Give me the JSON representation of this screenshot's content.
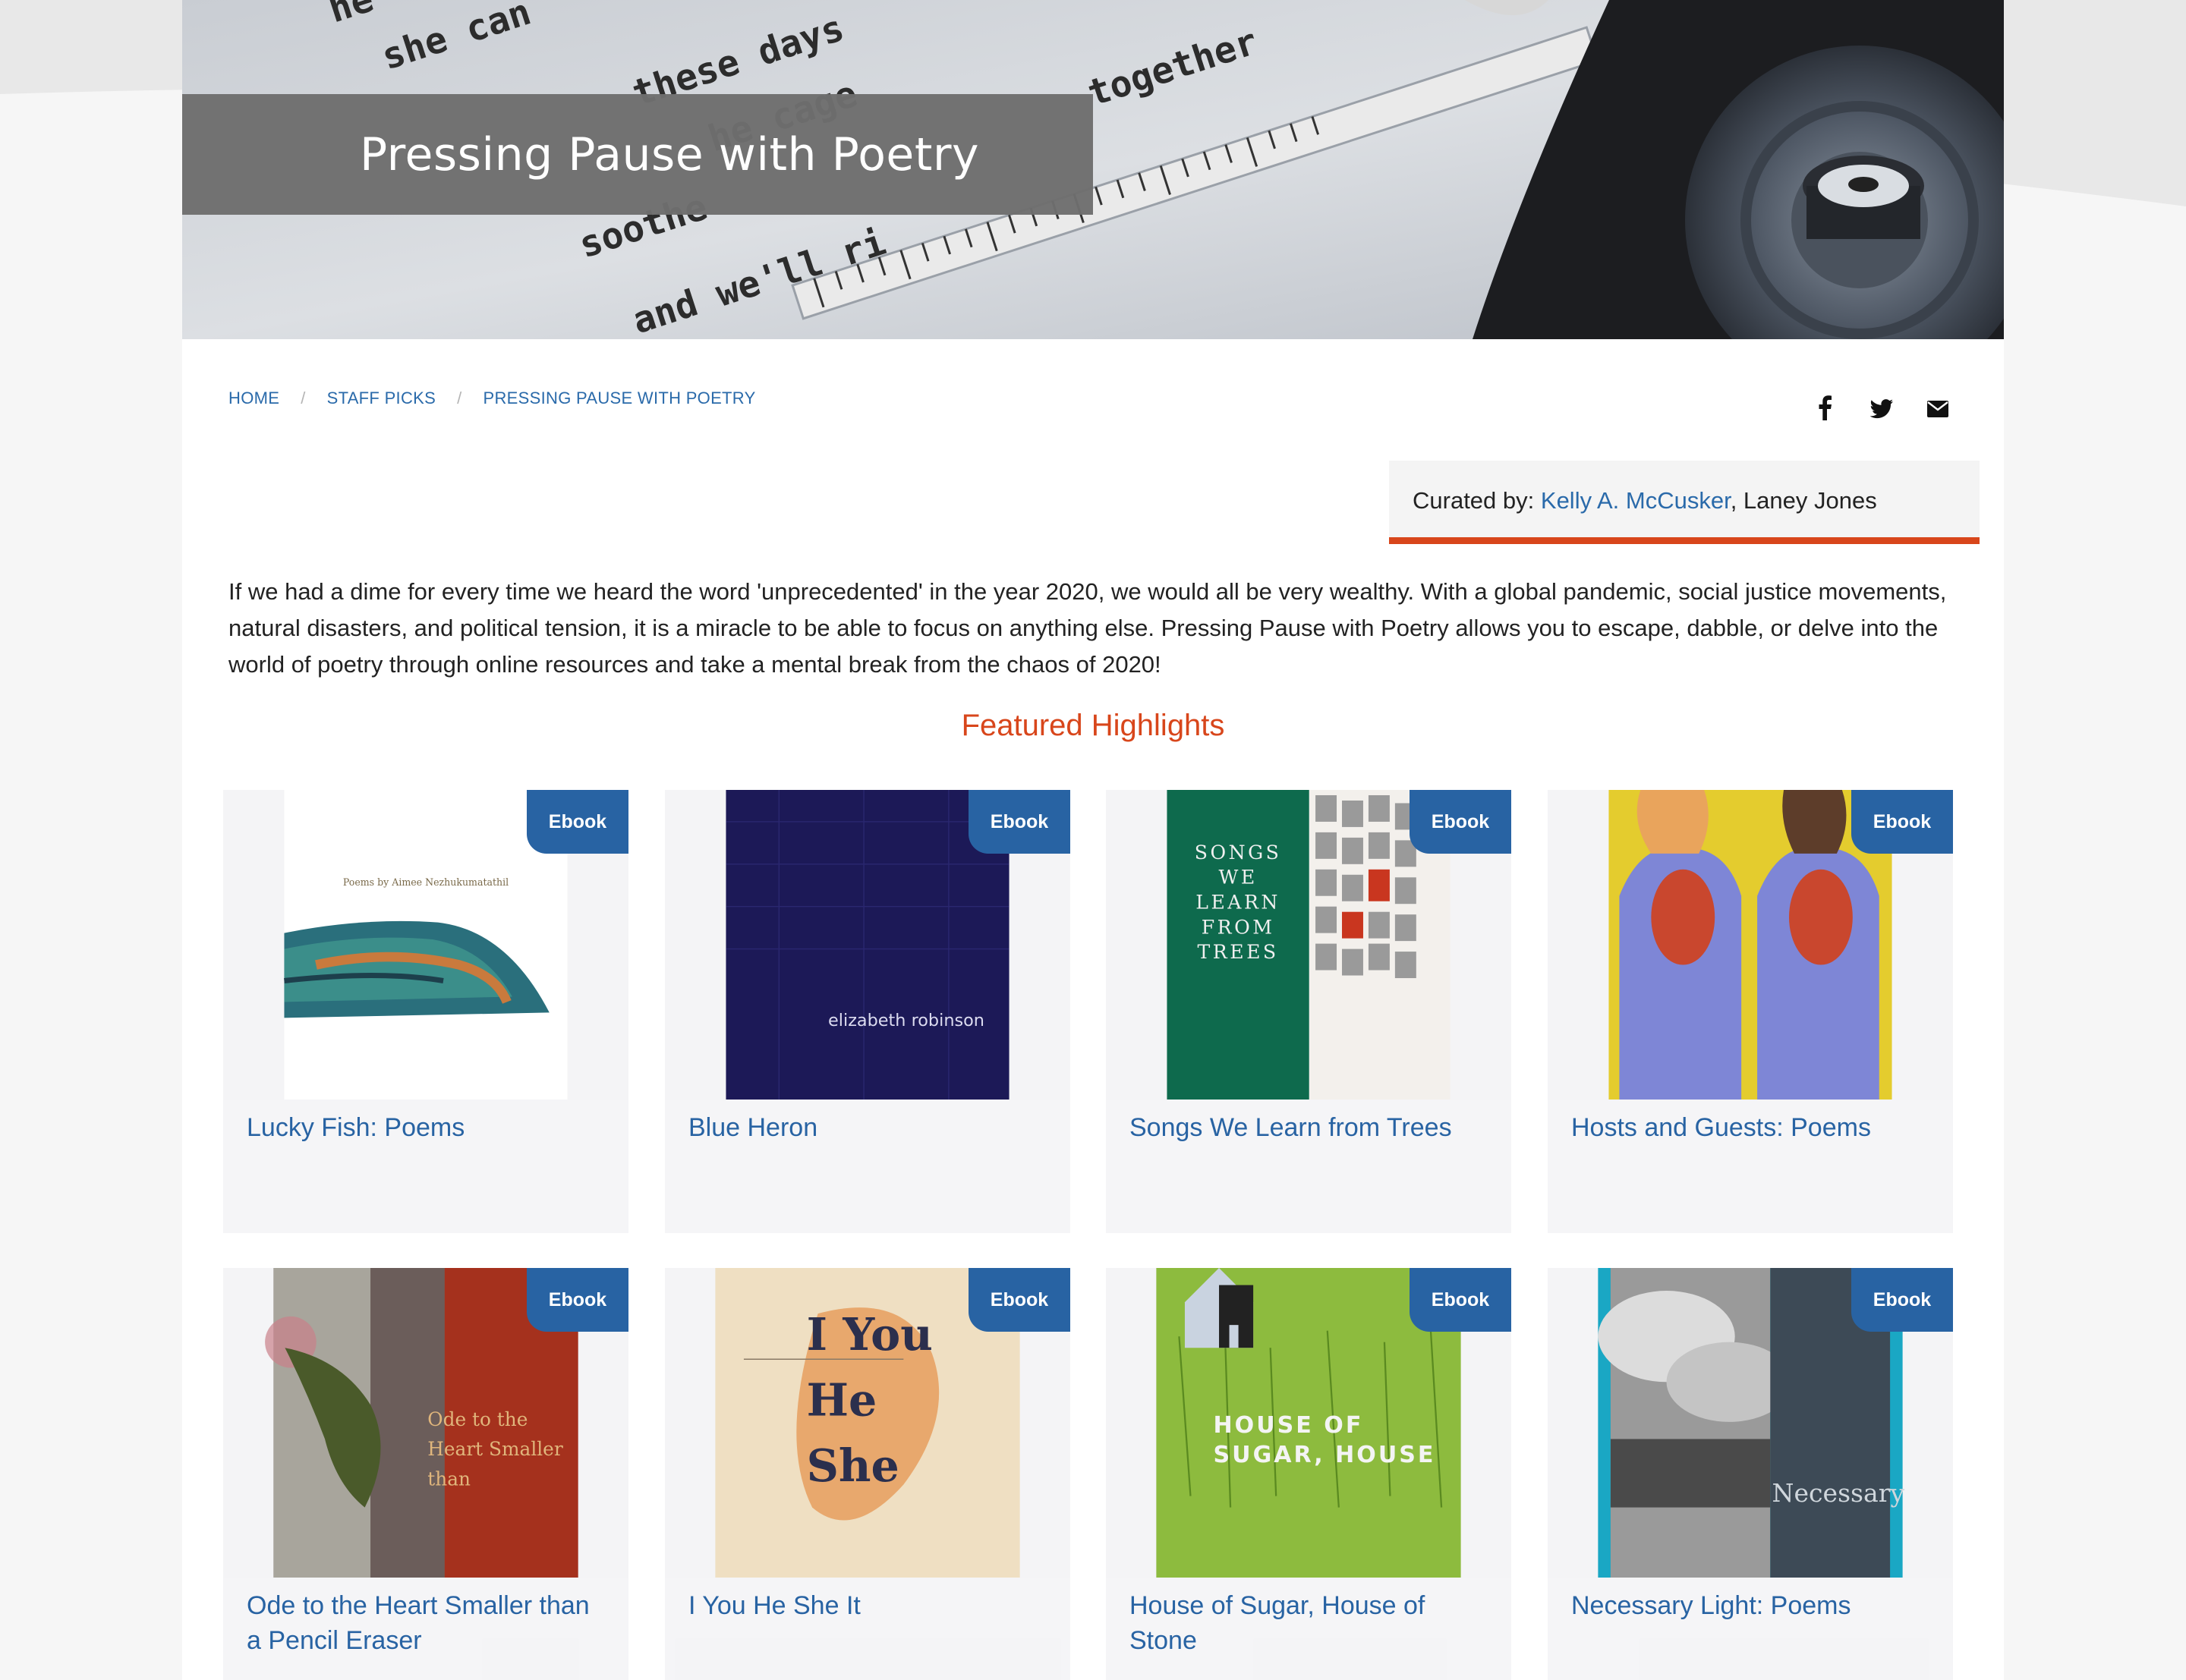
{
  "hero": {
    "title": "Pressing Pause with Poetry"
  },
  "breadcrumb": {
    "items": [
      "HOME",
      "STAFF PICKS",
      "PRESSING PAUSE WITH POETRY"
    ],
    "separator": "/"
  },
  "social": {
    "icons": [
      "facebook-icon",
      "twitter-icon",
      "email-icon"
    ]
  },
  "curated": {
    "label": "Curated by:",
    "curator_link": "Kelly A. McCusker",
    "rest": ", Laney Jones"
  },
  "intro": "If we had a dime for every time we heard the word 'unprecedented' in the year 2020, we would all be very wealthy. With a global pandemic, social justice movements, natural disasters, and political tension, it is a miracle to be able to focus on anything else. Pressing Pause with Poetry allows you to escape, dabble, or delve into the world of poetry through online resources and take a mental break from the chaos of 2020!",
  "featured_heading": "Featured Highlights",
  "books": [
    {
      "title": "Lucky Fish: Poems",
      "badge": "Ebook",
      "cover_text": "Poems by Aimee Nezhukumatathil"
    },
    {
      "title": "Blue Heron",
      "badge": "Ebook",
      "cover_text": "elizabeth robinson"
    },
    {
      "title": "Songs We Learn from Trees",
      "badge": "Ebook",
      "cover_text": "SONGS WE LEARN FROM TREES"
    },
    {
      "title": "Hosts and Guests: Poems",
      "badge": "Ebook",
      "cover_text": ""
    },
    {
      "title": "Ode to the Heart Smaller than a Pencil Eraser",
      "badge": "Ebook",
      "cover_text": "Ode to the Heart Smaller than"
    },
    {
      "title": "I You He She It",
      "badge": "Ebook",
      "cover_text": "I You He She"
    },
    {
      "title": "House of Sugar, House of Stone",
      "badge": "Ebook",
      "cover_text": "HOUSE OF SUGAR, HOUSE"
    },
    {
      "title": "Necessary Light: Poems",
      "badge": "Ebook",
      "cover_text": "Necessary"
    }
  ],
  "colors": {
    "accent": "#d8461b",
    "link": "#2a6aaa",
    "badge": "#2863a3"
  }
}
